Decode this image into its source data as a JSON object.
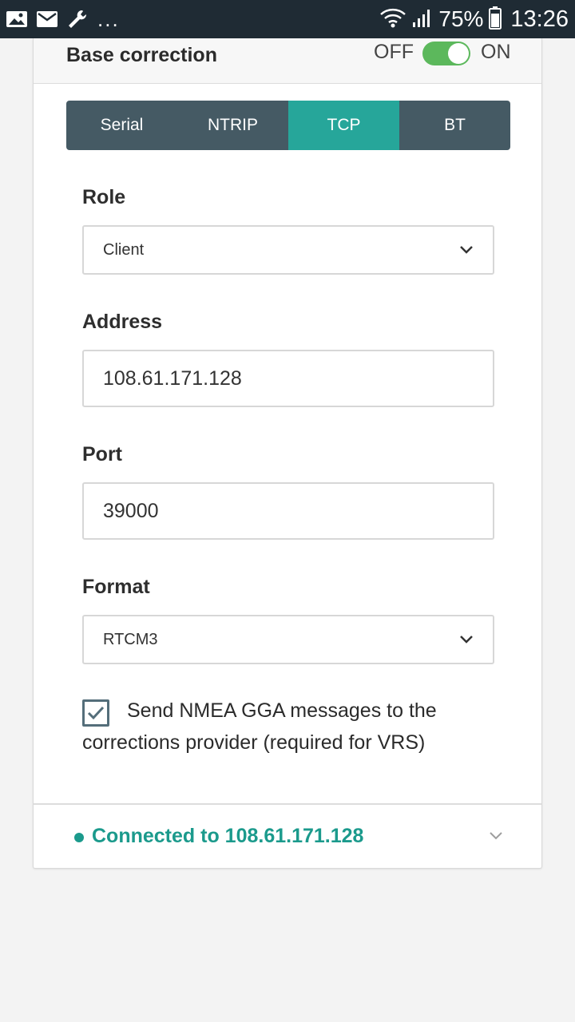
{
  "statusbar": {
    "battery_percent": "75%",
    "time": "13:26",
    "more": "...",
    "icons": [
      "image-icon",
      "mail-icon",
      "wrench-icon",
      "wifi-icon",
      "signal-icon",
      "battery-icon"
    ]
  },
  "card": {
    "header": {
      "title": "Base correction",
      "toggle_off_label": "OFF",
      "toggle_on_label": "ON",
      "toggle_state": "on"
    },
    "tabs": [
      {
        "label": "Serial",
        "active": false
      },
      {
        "label": "NTRIP",
        "active": false
      },
      {
        "label": "TCP",
        "active": true
      },
      {
        "label": "BT",
        "active": false
      }
    ],
    "role": {
      "label": "Role",
      "value": "Client"
    },
    "address": {
      "label": "Address",
      "value": "108.61.171.128"
    },
    "port": {
      "label": "Port",
      "value": "39000"
    },
    "format": {
      "label": "Format",
      "value": "RTCM3"
    },
    "gga": {
      "checked": true,
      "label": "Send NMEA GGA messages to the corrections provider (required for VRS)"
    },
    "footer": {
      "status": "Connected to 108.61.171.128"
    }
  },
  "colors": {
    "accent": "#26a69a",
    "tabs_bg": "#455a64",
    "switch_on": "#5cb85c",
    "status_text": "#1b9a8c",
    "statusbar": "#1f2b34"
  }
}
